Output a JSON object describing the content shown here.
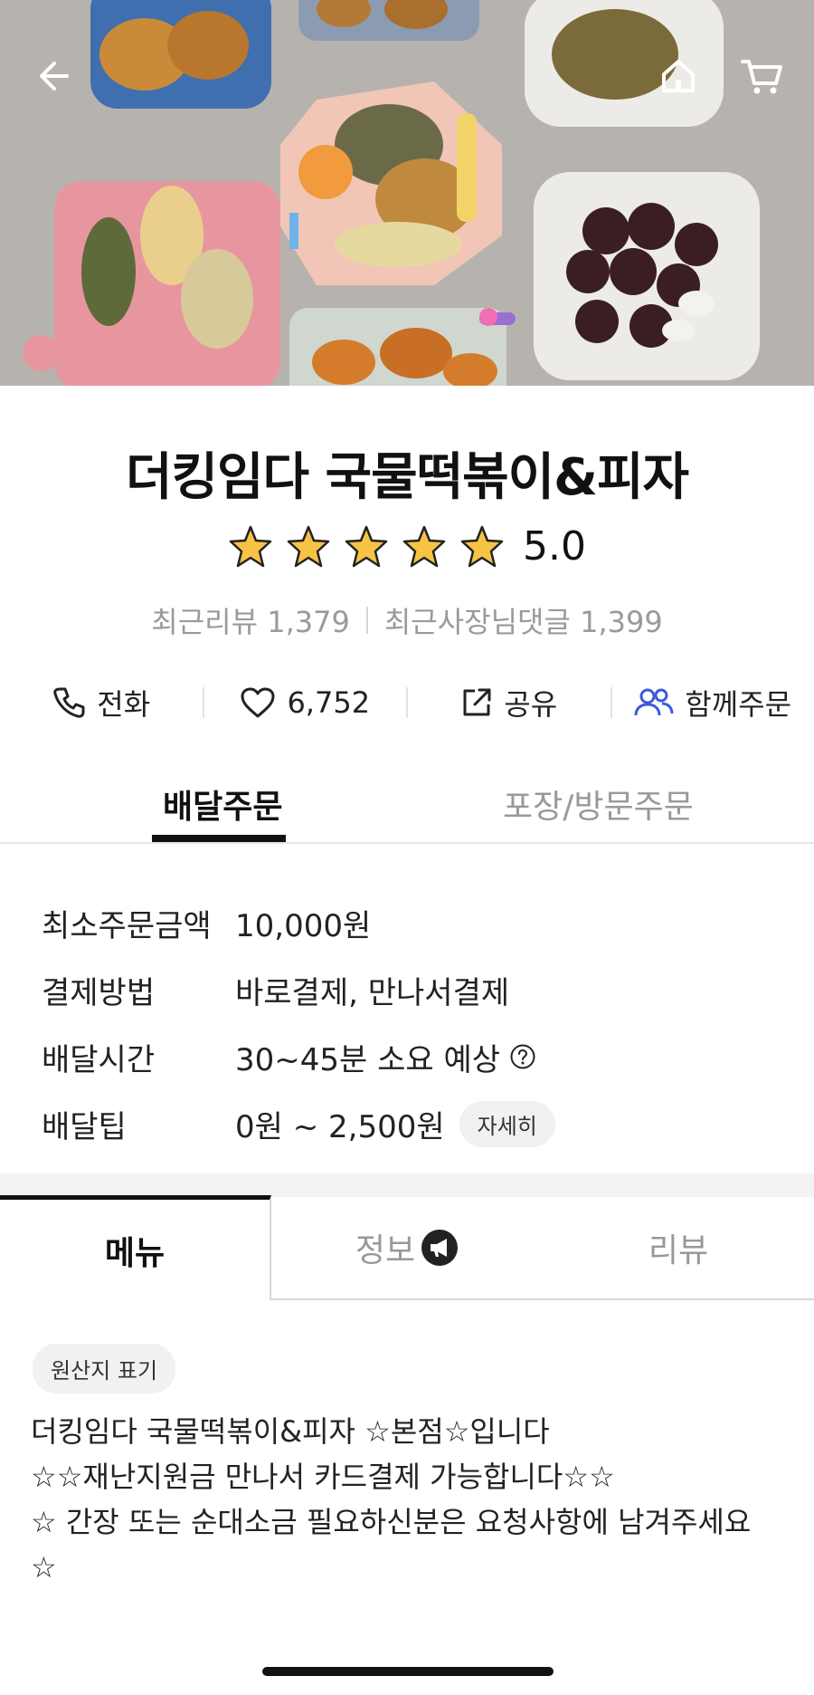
{
  "hero": {
    "back_icon": "arrow-left-icon",
    "home_icon": "home-icon",
    "cart_icon": "cart-icon"
  },
  "store": {
    "name": "더킹임다 국물떡볶이&피자",
    "rating": "5.0",
    "rating_stars": 5,
    "recent_reviews": "최근리뷰 1,379",
    "recent_owner_replies": "최근사장님댓글 1,399"
  },
  "actions": [
    {
      "icon": "phone-icon",
      "label": "전화"
    },
    {
      "icon": "heart-icon",
      "label": "6,752"
    },
    {
      "icon": "share-icon",
      "label": "공유"
    },
    {
      "icon": "group-icon",
      "label": "함께주문"
    }
  ],
  "order_tabs": {
    "delivery": "배달주문",
    "pickup": "포장/방문주문",
    "selected": "delivery"
  },
  "info": {
    "min_order_label": "최소주문금액",
    "min_order_value": "10,000원",
    "payment_label": "결제방법",
    "payment_value": "바로결제, 만나서결제",
    "delivery_time_label": "배달시간",
    "delivery_time_value": "30~45분 소요 예상",
    "delivery_tip_label": "배달팁",
    "delivery_tip_value": "0원 ~ 2,500원",
    "detail_button": "자세히"
  },
  "menu_tabs": {
    "menu": "메뉴",
    "info": "정보",
    "review": "리뷰",
    "selected": "menu"
  },
  "notice": {
    "origin_chip": "원산지 표기",
    "lines": [
      "더킹임다 국물떡볶이&피자 ☆본점☆입니다",
      "☆☆재난지원금 만나서 카드결제 가능합니다☆☆",
      "☆ 간장 또는 순대소금 필요하신분은 요청사항에 남겨주세요",
      "☆"
    ]
  },
  "colors": {
    "accent_blue": "#3a5bd9",
    "star_gold": "#f6c344",
    "text_dark": "#111111",
    "text_gray": "#9a9a9a"
  }
}
